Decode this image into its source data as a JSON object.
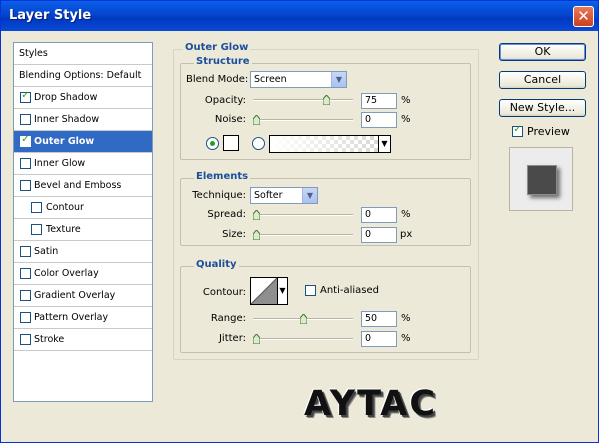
{
  "window": {
    "title": "Layer Style",
    "close_glyph": "✕"
  },
  "styles_list": {
    "items": [
      {
        "label": "Styles",
        "checkbox": false,
        "checked": false,
        "selected": false
      },
      {
        "label": "Blending Options: Default",
        "checkbox": false,
        "checked": false,
        "selected": false
      },
      {
        "label": "Drop Shadow",
        "checkbox": true,
        "checked": true,
        "selected": false
      },
      {
        "label": "Inner Shadow",
        "checkbox": true,
        "checked": false,
        "selected": false
      },
      {
        "label": "Outer Glow",
        "checkbox": true,
        "checked": true,
        "selected": true
      },
      {
        "label": "Inner Glow",
        "checkbox": true,
        "checked": false,
        "selected": false
      },
      {
        "label": "Bevel and Emboss",
        "checkbox": true,
        "checked": false,
        "selected": false
      },
      {
        "label": "Contour",
        "checkbox": true,
        "checked": false,
        "selected": false
      },
      {
        "label": "Texture",
        "checkbox": true,
        "checked": false,
        "selected": false
      },
      {
        "label": "Satin",
        "checkbox": true,
        "checked": false,
        "selected": false
      },
      {
        "label": "Color Overlay",
        "checkbox": true,
        "checked": false,
        "selected": false
      },
      {
        "label": "Gradient Overlay",
        "checkbox": true,
        "checked": false,
        "selected": false
      },
      {
        "label": "Pattern Overlay",
        "checkbox": true,
        "checked": false,
        "selected": false
      },
      {
        "label": "Stroke",
        "checkbox": true,
        "checked": false,
        "selected": false
      }
    ]
  },
  "panel": {
    "title": "Outer Glow",
    "structure": {
      "title": "Structure",
      "blend_mode_label": "Blend Mode:",
      "blend_mode_value": "Screen",
      "opacity_label": "Opacity:",
      "opacity_value": "75",
      "opacity_level": 0.75,
      "noise_label": "Noise:",
      "noise_value": "0",
      "noise_level": 0,
      "unit_percent": "%",
      "color_swatch": "#ffffff",
      "color_radio_selected": true
    },
    "elements": {
      "title": "Elements",
      "technique_label": "Technique:",
      "technique_value": "Softer",
      "spread_label": "Spread:",
      "spread_value": "0",
      "spread_level": 0,
      "size_label": "Size:",
      "size_value": "0",
      "size_level": 0,
      "unit_percent": "%",
      "unit_px": "px"
    },
    "quality": {
      "title": "Quality",
      "contour_label": "Contour:",
      "anti_aliased_label": "Anti-aliased",
      "anti_aliased_checked": false,
      "range_label": "Range:",
      "range_value": "50",
      "range_level": 0.5,
      "jitter_label": "Jitter:",
      "jitter_value": "0",
      "jitter_level": 0,
      "unit_percent": "%"
    }
  },
  "buttons": {
    "ok": "OK",
    "cancel": "Cancel",
    "new_style": "New Style..."
  },
  "preview": {
    "label": "Preview",
    "checked": true
  },
  "watermark": "AYTAC",
  "colors": {
    "title_bar": "#0a5fe8",
    "selection": "#316ac5",
    "group_title": "#1b4f9c",
    "check": "#21a121",
    "dialog_bg": "#ece9d8"
  },
  "icons": {
    "dropdown": "chevron-down-icon",
    "check": "check-icon",
    "close": "close-icon"
  }
}
